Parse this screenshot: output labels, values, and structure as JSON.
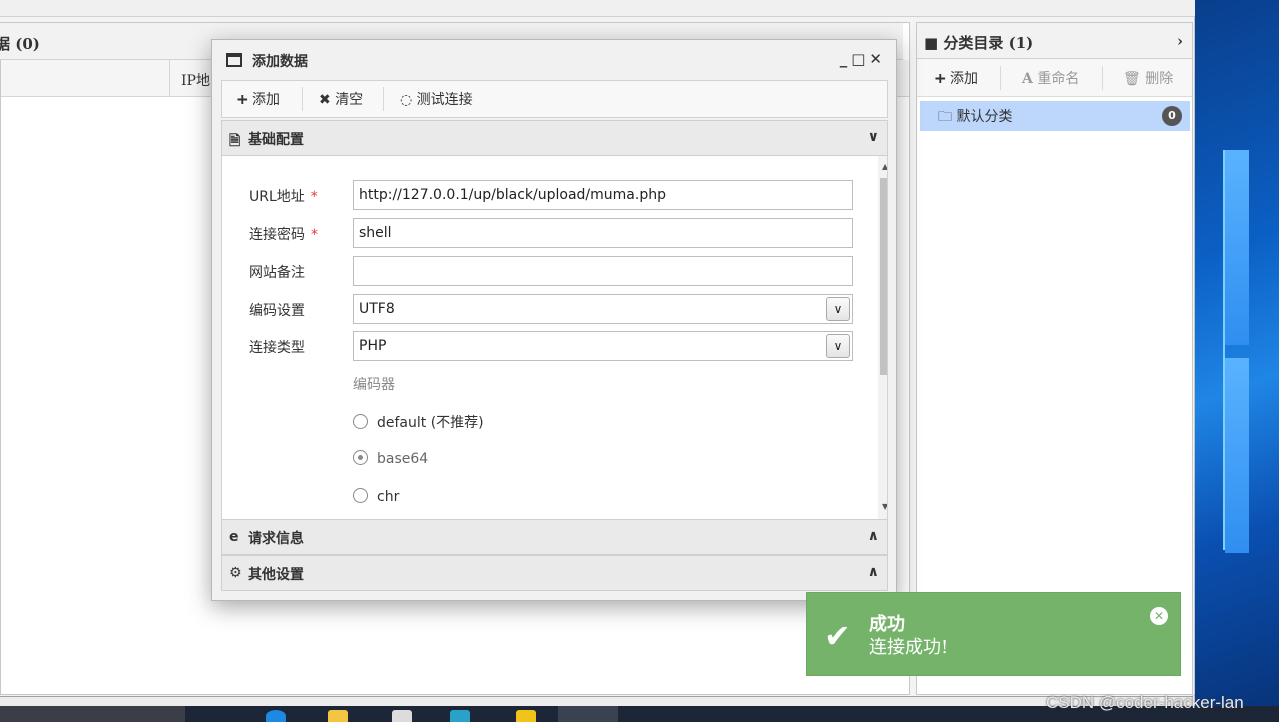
{
  "left_panel": {
    "title": "据 (0)",
    "column_ip": "IP地"
  },
  "right_panel": {
    "title": "分类目录 (1)",
    "toolbar": {
      "add": "添加",
      "rename": "重命名",
      "delete": "删除"
    },
    "category": {
      "label": "默认分类",
      "count": "0"
    }
  },
  "dialog": {
    "title": "添加数据",
    "controls": "_ ▢ ✕",
    "toolbar": {
      "add": "添加",
      "clear": "清空",
      "test": "测试连接"
    },
    "sections": {
      "basic": "基础配置",
      "request": "请求信息",
      "other": "其他设置"
    },
    "form": {
      "url_label": "URL地址",
      "url_value": "http://127.0.0.1/up/black/upload/muma.php",
      "password_label": "连接密码",
      "password_value": "shell",
      "note_label": "网站备注",
      "note_value": "",
      "encoding_label": "编码设置",
      "encoding_value": "UTF8",
      "type_label": "连接类型",
      "type_value": "PHP",
      "required_mark": "*",
      "encoder_title": "编码器",
      "encoders": [
        {
          "label": "default (不推荐)",
          "checked": false
        },
        {
          "label": "base64",
          "checked": true
        },
        {
          "label": "chr",
          "checked": false
        }
      ]
    }
  },
  "toast": {
    "title": "成功",
    "message": "连接成功!"
  },
  "watermark": "CSDN @coder-hacker-lan",
  "colors": {
    "toast_bg": "#75b36a",
    "selected_bg": "#bcd7fb",
    "required": "#e53935"
  }
}
